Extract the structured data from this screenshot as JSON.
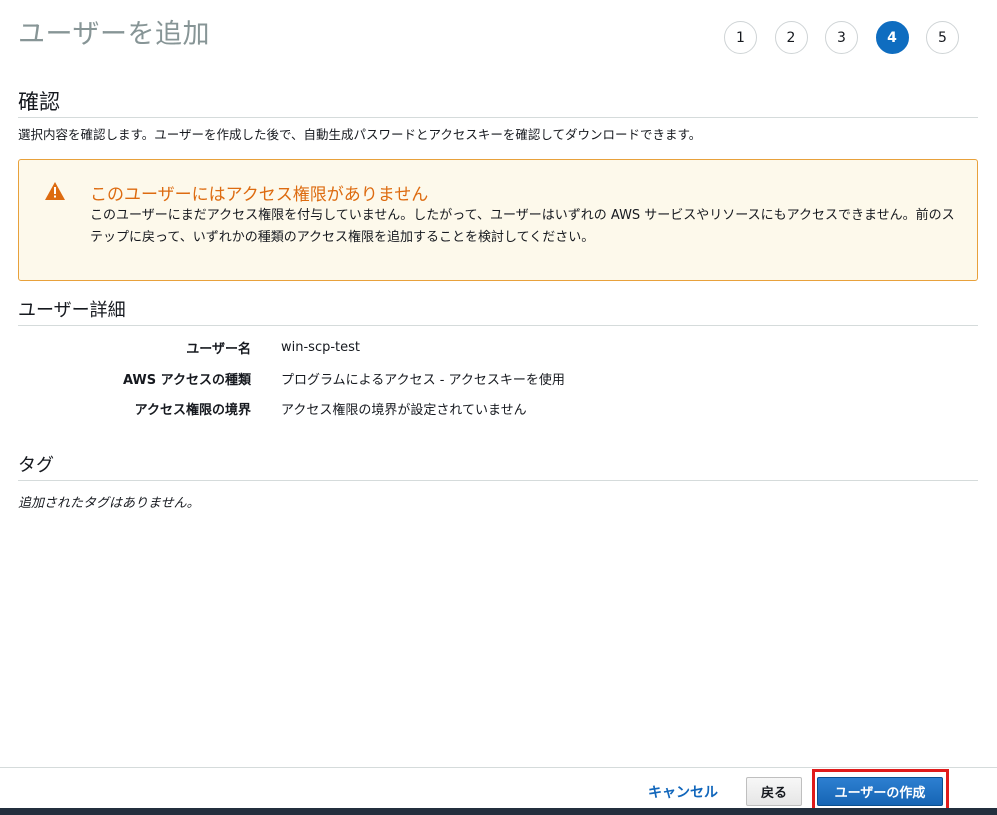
{
  "header": {
    "title": "ユーザーを追加",
    "steps": [
      "1",
      "2",
      "3",
      "4",
      "5"
    ],
    "active_step": "4"
  },
  "review": {
    "heading": "確認",
    "description": "選択内容を確認します。ユーザーを作成した後で、自動生成パスワードとアクセスキーを確認してダウンロードできます。"
  },
  "warning": {
    "icon": "warning-triangle-icon",
    "title": "このユーザーにはアクセス権限がありません",
    "body": "このユーザーにまだアクセス権限を付与していません。したがって、ユーザーはいずれの AWS サービスやリソースにもアクセスできません。前のステップに戻って、いずれかの種類のアクセス権限を追加することを検討してください。",
    "colors": {
      "accent": "#dd6b10",
      "background": "#fdf9eb",
      "border": "#e8a13b"
    }
  },
  "user_details": {
    "heading": "ユーザー詳細",
    "rows": [
      {
        "label": "ユーザー名",
        "value": "win-scp-test"
      },
      {
        "label": "AWS アクセスの種類",
        "value": "プログラムによるアクセス - アクセスキーを使用"
      },
      {
        "label": "アクセス権限の境界",
        "value": "アクセス権限の境界が設定されていません"
      }
    ]
  },
  "tags": {
    "heading": "タグ",
    "empty_text": "追加されたタグはありません。"
  },
  "footer": {
    "cancel_label": "キャンセル",
    "back_label": "戻る",
    "create_label": "ユーザーの作成",
    "colors": {
      "primary": "#1665b4",
      "link": "#1166bb",
      "highlight": "#e01b1b"
    }
  }
}
